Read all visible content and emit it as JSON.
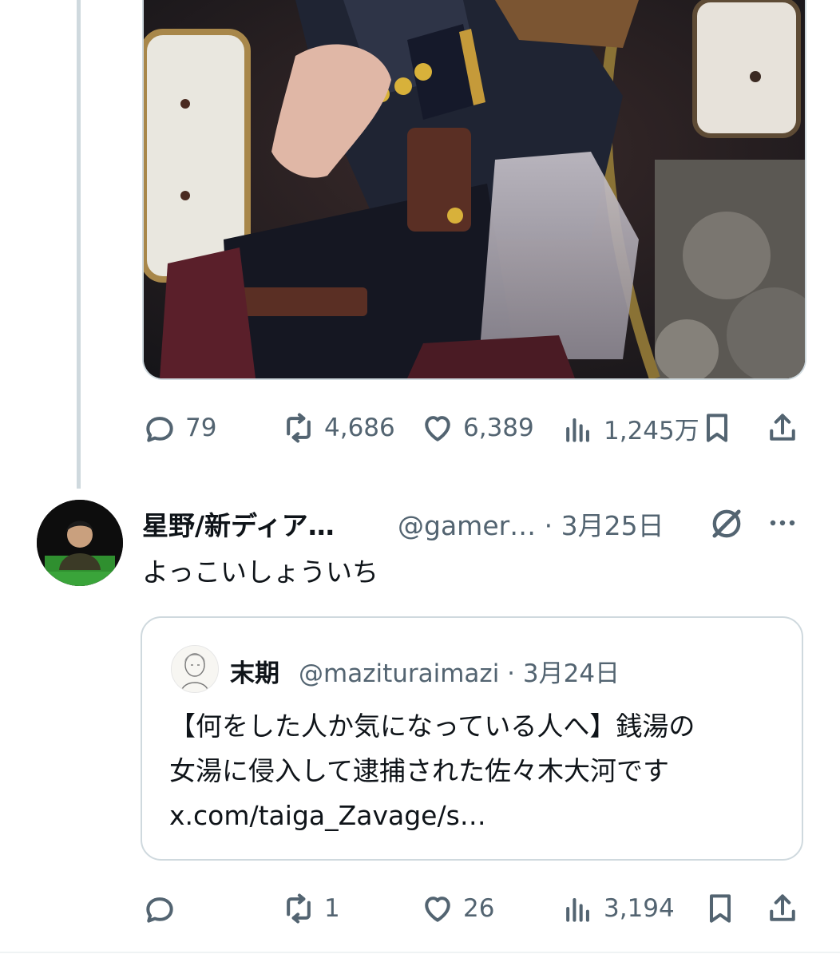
{
  "parent_tweet": {
    "stats": {
      "replies": "79",
      "reposts": "4,686",
      "likes": "6,389",
      "views": "1,245万"
    }
  },
  "reply_tweet": {
    "display_name": "星野/新ディア…",
    "handle_date": "@gamer… · 3月25日",
    "text": "よっこいしょういち",
    "quoted": {
      "name": "末期",
      "handle_date": "@mazituraimazi · 3月24日",
      "lines": [
        "【何をした人か気になっている人へ】銭湯の",
        "女湯に侵入して逮捕された佐々木大河です",
        "x.com/taiga_Zavage/s…"
      ]
    },
    "stats": {
      "replies": "",
      "reposts": "1",
      "likes": "26",
      "views": "3,194"
    }
  },
  "icons": [
    "reply-icon",
    "repost-icon",
    "like-icon",
    "views-icon",
    "bookmark-icon",
    "share-icon",
    "grok-icon",
    "more-icon"
  ],
  "colors": {
    "muted": "#536471",
    "text": "#0f1419",
    "border": "#cfd9de"
  }
}
